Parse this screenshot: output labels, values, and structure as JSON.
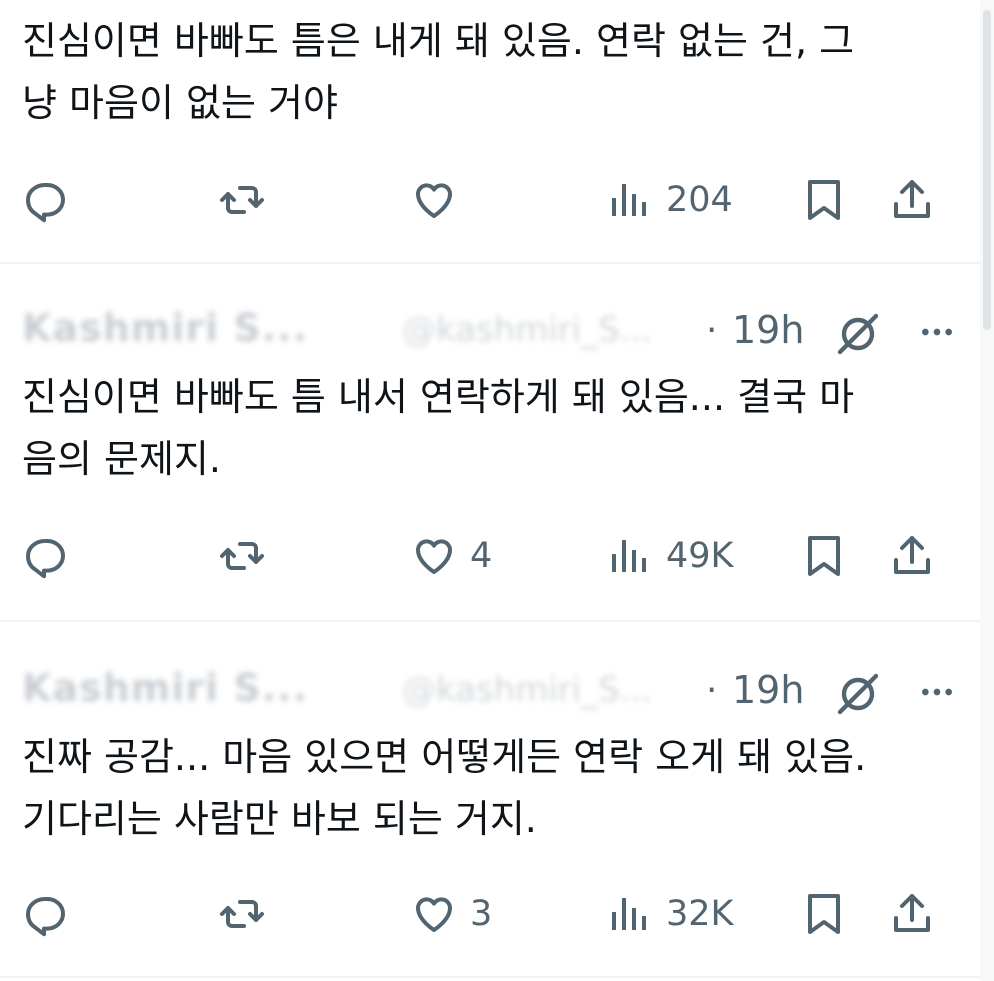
{
  "posts": [
    {
      "author": "",
      "handle": "",
      "time": "",
      "text": "진심이면 바빠도 틈은 내게 돼 있음. 연락 없는 건, 그\n냥 마음이 없는 거야",
      "likes": "",
      "views": "204"
    },
    {
      "author": "Kashmiri S...",
      "handle": "@kashmiri_S...",
      "time": "19h",
      "text": "진심이면 바빠도 틈 내서 연락하게 돼 있음... 결국 마\n음의 문제지.",
      "likes": "4",
      "views": "49K"
    },
    {
      "author": "Kashmiri S...",
      "handle": "@kashmiri_S...",
      "time": "19h",
      "text": "진짜 공감... 마음 있으면 어떻게든 연락 오게 돼 있음.\n기다리는 사람만 바보 되는 거지.",
      "likes": "3",
      "views": "32K"
    }
  ],
  "icons": {
    "reply": "reply-icon",
    "retweet": "retweet-icon",
    "like": "heart-icon",
    "views": "views-icon",
    "bookmark": "bookmark-icon",
    "share": "share-icon",
    "grok": "grok-icon",
    "more": "more-icon"
  },
  "colors": {
    "icon": "#536471",
    "text": "#0f1419",
    "divider": "#eff3f4"
  }
}
